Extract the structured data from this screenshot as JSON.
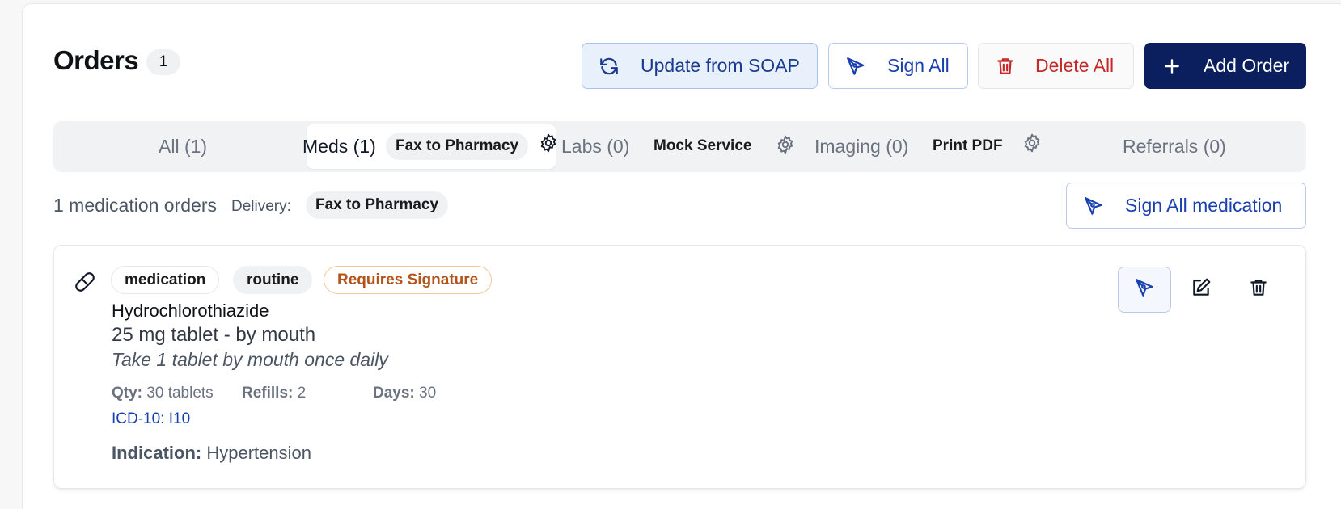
{
  "header": {
    "title": "Orders",
    "count": "1",
    "buttons": {
      "update_soap": "Update from SOAP",
      "sign_all": "Sign All",
      "delete_all": "Delete All",
      "add_order": "Add Order"
    }
  },
  "tabs": {
    "all": "All (1)",
    "meds": "Meds (1)",
    "meds_service": "Fax to Pharmacy",
    "labs": "Labs (0)",
    "labs_service": "Mock Service",
    "imaging": "Imaging (0)",
    "imaging_service": "Print PDF",
    "referrals": "Referrals (0)"
  },
  "subheader": {
    "summary": "1 medication orders",
    "delivery_label": "Delivery:",
    "delivery_value": "Fax to Pharmacy",
    "sign_all_medication": "Sign All medication"
  },
  "order": {
    "tags": {
      "type": "medication",
      "priority": "routine",
      "status": "Requires Signature"
    },
    "drug": "Hydrochlorothiazide",
    "dose": "25 mg tablet - by mouth",
    "sig": "Take 1 tablet by mouth once daily",
    "qty_label": "Qty:",
    "qty_value": "30 tablets",
    "refills_label": "Refills:",
    "refills_value": "2",
    "days_label": "Days:",
    "days_value": "30",
    "icd": "ICD-10: I10",
    "indication_label": "Indication:",
    "indication_value": "Hypertension"
  },
  "colors": {
    "primary_navy": "#0b1f5e",
    "link_blue": "#1a3fb0",
    "danger_red": "#c62828",
    "warning_orange": "#b4531a"
  },
  "icons": [
    "refresh-icon",
    "pen-icon",
    "trash-icon",
    "plus-icon",
    "gear-icon",
    "pill-icon",
    "edit-icon"
  ]
}
